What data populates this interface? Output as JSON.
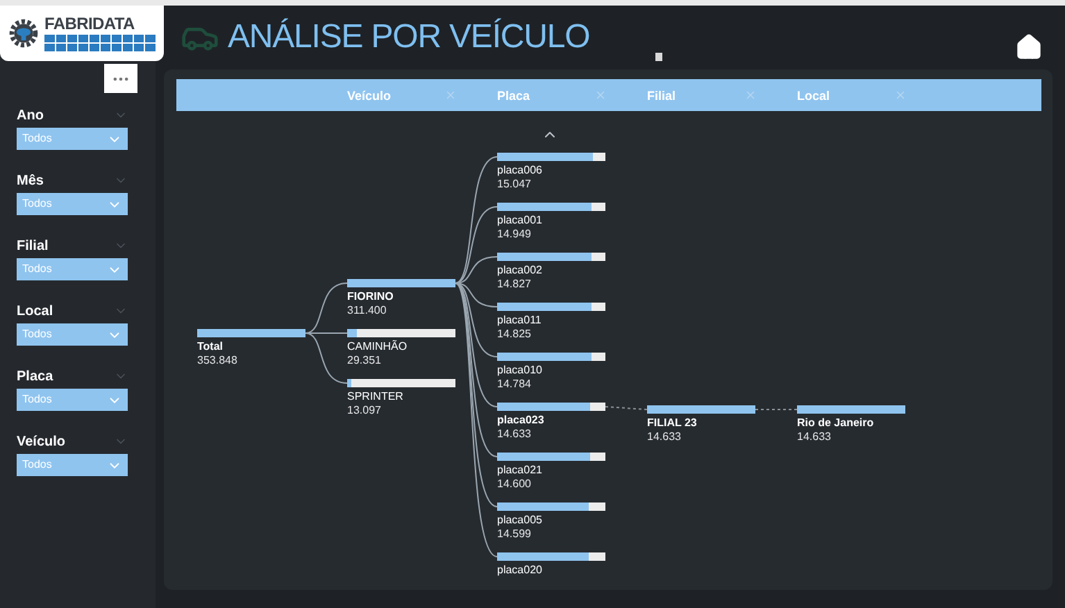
{
  "logo": {
    "text": "FABRIDATA"
  },
  "filters": [
    {
      "label": "Ano",
      "value": "Todos"
    },
    {
      "label": "Mês",
      "value": "Todos"
    },
    {
      "label": "Filial",
      "value": "Todos"
    },
    {
      "label": "Local",
      "value": "Todos"
    },
    {
      "label": "Placa",
      "value": "Todos"
    },
    {
      "label": "Veículo",
      "value": "Todos"
    }
  ],
  "title": "ANÁLISE POR VEÍCULO",
  "tree": {
    "levels": [
      {
        "label": "Veículo"
      },
      {
        "label": "Placa"
      },
      {
        "label": "Filial"
      },
      {
        "label": "Local"
      }
    ],
    "root": {
      "label": "Total",
      "value": "353.848",
      "level": 1,
      "selected": true,
      "children": [
        {
          "label": "FIORINO",
          "value": "311.400",
          "level": 1,
          "selected": true,
          "children": [
            {
              "label": "placa006",
              "value": "15.047",
              "level": 0.88,
              "selected": false
            },
            {
              "label": "placa001",
              "value": "14.949",
              "level": 0.87,
              "selected": false
            },
            {
              "label": "placa002",
              "value": "14.827",
              "level": 0.87,
              "selected": false
            },
            {
              "label": "placa011",
              "value": "14.825",
              "level": 0.87,
              "selected": false
            },
            {
              "label": "placa010",
              "value": "14.784",
              "level": 0.87,
              "selected": false
            },
            {
              "label": "placa023",
              "value": "14.633",
              "level": 0.86,
              "selected": true,
              "children": [
                {
                  "label": "FILIAL 23",
                  "value": "14.633",
                  "level": 1,
                  "selected": true,
                  "children": [
                    {
                      "label": "Rio de Janeiro",
                      "value": "14.633",
                      "level": 1,
                      "selected": true
                    }
                  ]
                }
              ]
            },
            {
              "label": "placa021",
              "value": "14.600",
              "level": 0.86,
              "selected": false
            },
            {
              "label": "placa005",
              "value": "14.599",
              "level": 0.85,
              "selected": false
            },
            {
              "label": "placa020",
              "level": 0.85,
              "selected": false
            }
          ]
        },
        {
          "label": "CAMINHÃO",
          "value": "29.351",
          "level": 0.09,
          "selected": false
        },
        {
          "label": "SPRINTER",
          "value": "13.097",
          "level": 0.04,
          "selected": false
        }
      ]
    }
  }
}
